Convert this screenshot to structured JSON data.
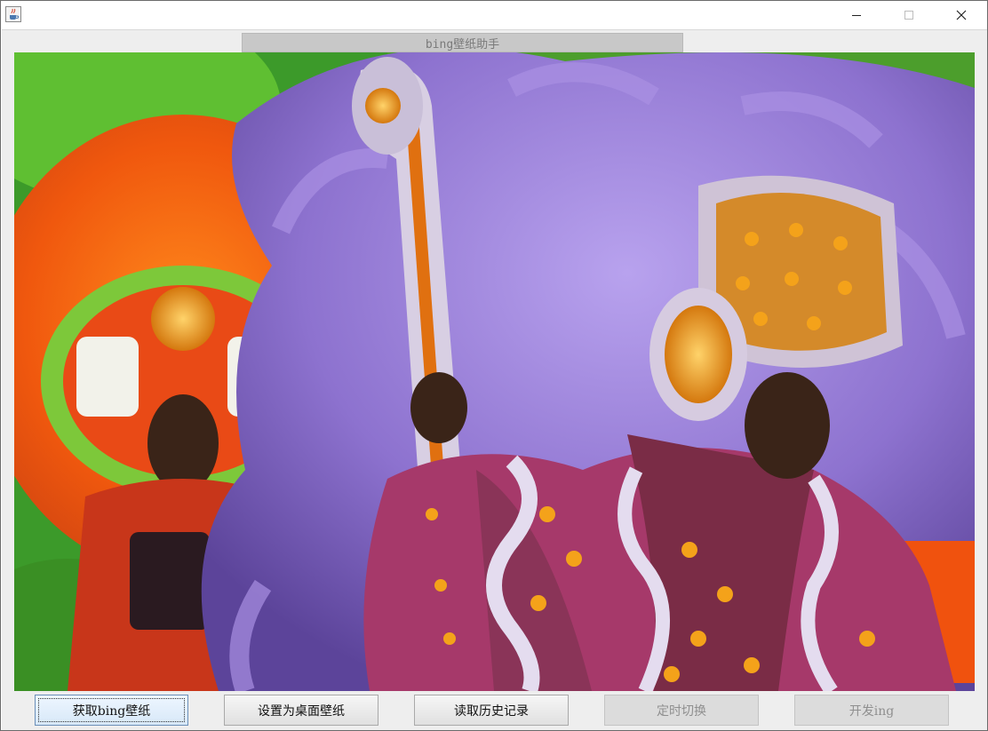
{
  "window": {
    "title_label": "bing壁纸助手",
    "app_icon": "java-cup-icon",
    "controls": {
      "minimize": "minimize-icon",
      "maximize": "maximize-icon",
      "close": "close-icon"
    }
  },
  "wallpaper": {
    "icon": "wallpaper-image"
  },
  "buttons": {
    "fetch": "获取bing壁纸",
    "set_desktop": "设置为桌面壁纸",
    "history": "读取历史记录",
    "timer": "定时切换",
    "dev": "开发ing"
  },
  "colors": {
    "button_focus_border": "#6b8fb8",
    "disabled_text": "#8f8f8f",
    "title_bg": "#c8c8c8"
  }
}
